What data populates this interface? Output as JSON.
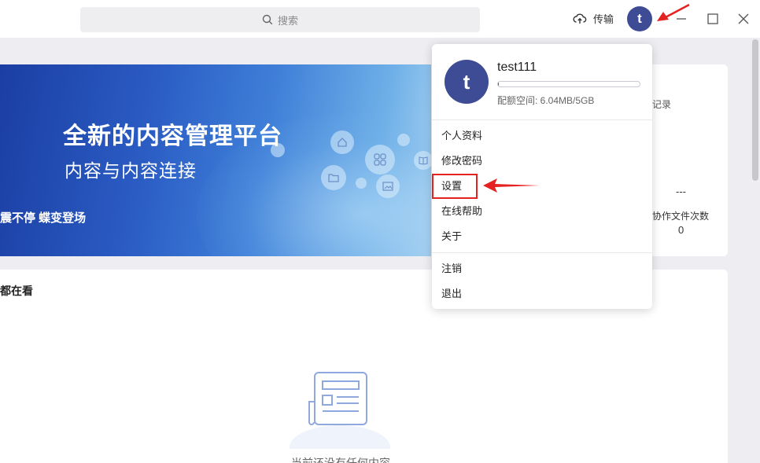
{
  "topbar": {
    "search_placeholder": "搜索",
    "transfer_label": "传输",
    "avatar_letter": "t"
  },
  "banner": {
    "title": "全新的内容管理平台",
    "subtitle": "内容与内容连接",
    "tagline": "震不停 蝶变登场"
  },
  "stats": {
    "record_label": "记录",
    "dash_value": "---",
    "work_label": "协作文件次数",
    "work_value": "0"
  },
  "content": {
    "section_title": "都在看",
    "empty_text": "当前还没有任何内容"
  },
  "user_menu": {
    "avatar_letter": "t",
    "username": "test111",
    "quota_text": "配额空间: 6.04MB/5GB",
    "quota_fraction": 0.0012,
    "items": [
      {
        "label": "个人资料"
      },
      {
        "label": "修改密码"
      },
      {
        "label": "设置"
      },
      {
        "label": "在线帮助"
      },
      {
        "label": "关于"
      },
      {
        "label": "注销"
      },
      {
        "label": "退出"
      }
    ]
  },
  "colors": {
    "accent": "#3d4c94",
    "annotation_red": "#e52222"
  }
}
